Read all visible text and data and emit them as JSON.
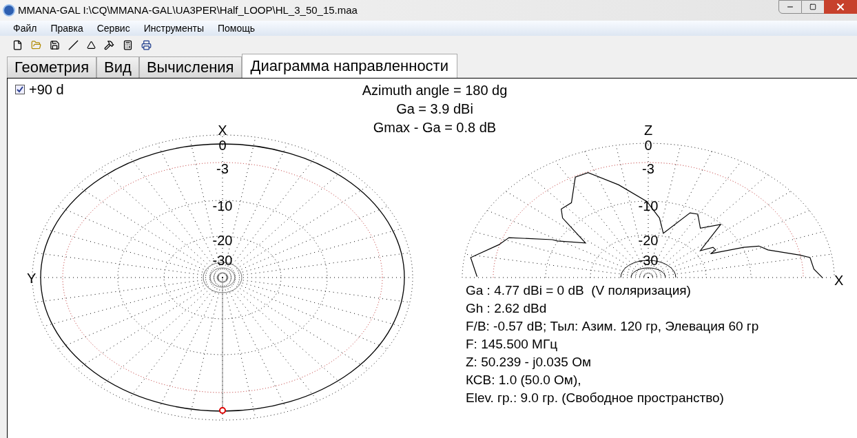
{
  "window": {
    "title": "MMANA-GAL I:\\CQ\\MMANA-GAL\\UA3PER\\Half_LOOP\\HL_3_50_15.maa"
  },
  "menu": [
    "Файл",
    "Правка",
    "Сервис",
    "Инструменты",
    "Помощь"
  ],
  "tabs": [
    {
      "label": "Геометрия",
      "selected": false
    },
    {
      "label": "Вид",
      "selected": false
    },
    {
      "label": "Вычисления",
      "selected": false
    },
    {
      "label": "Диаграмма направленности",
      "selected": true
    }
  ],
  "options": {
    "label": "+90 d",
    "checked": true
  },
  "header": [
    "Azimuth angle = 180 dg",
    "Ga = 3.9 dBi",
    "Gmax - Ga = 0.8 dB"
  ],
  "horizontal_plot": {
    "axis_top": "X",
    "axis_side": "Y",
    "rings": [
      "0",
      "-3",
      "-10",
      "-20",
      "-30"
    ]
  },
  "vertical_plot": {
    "axis_top": "Z",
    "axis_side": "X",
    "rings": [
      "0",
      "-3",
      "-10",
      "-20",
      "-30"
    ]
  },
  "results": [
    "Ga : 4.77 dBi = 0 dB  (V поляризация)",
    "Gh : 2.62 dBd",
    "F/B: -0.57 dB; Тыл: Азим. 120 гр, Элевация 60 гр",
    "F: 145.500 МГц",
    "Z: 50.239 - j0.035 Ом",
    "КСВ: 1.0 (50.0 Ом),",
    "Elev. гр.: 9.0 гр. (Свободное пространство)"
  ]
}
